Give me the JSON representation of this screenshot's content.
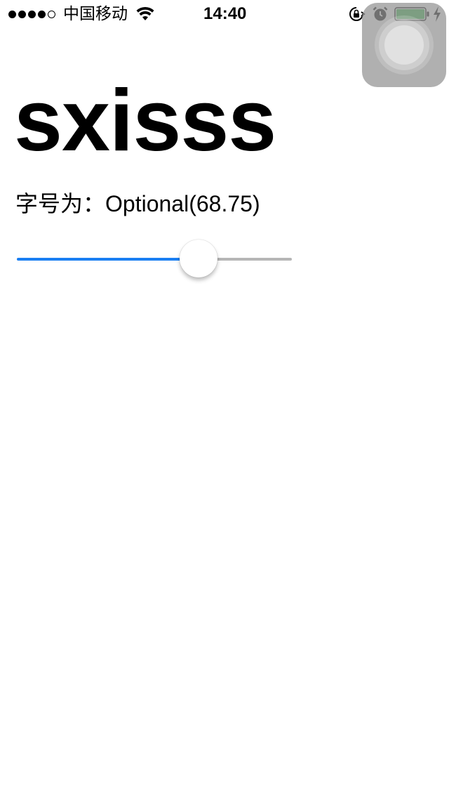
{
  "status_bar": {
    "carrier": "中国移动",
    "time": "14:40",
    "signal_bars_filled": 4,
    "signal_bars_total": 5,
    "battery_level": 1.0,
    "battery_color": "#35b84a",
    "icons": [
      "wifi-icon",
      "orientation-lock-icon",
      "alarm-icon",
      "battery-icon",
      "charging-icon"
    ]
  },
  "assistive_touch": {
    "icon": "assistive-touch-icon"
  },
  "main": {
    "preview_text": "sxisss",
    "size_label_prefix": "字号为：",
    "size_label_value": "Optional(68.75)",
    "slider": {
      "value": 0.66,
      "min_track_color": "#1a7ff2",
      "max_track_color": "#b6b6b6"
    }
  }
}
